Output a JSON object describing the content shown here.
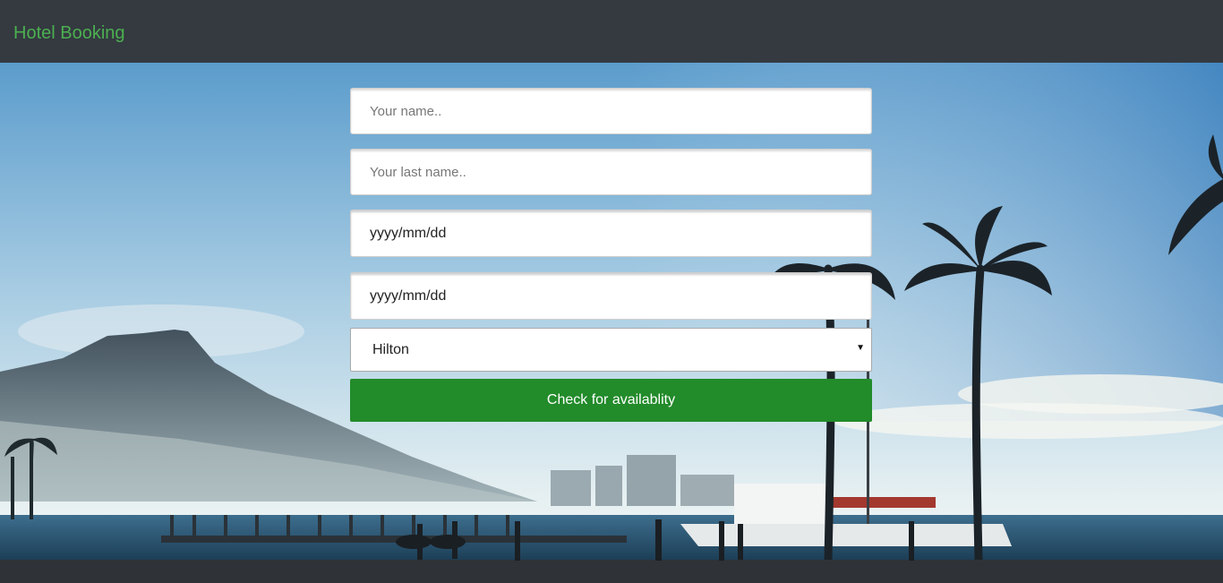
{
  "navbar": {
    "brand": "Hotel Booking",
    "brand_color": "#4caf50",
    "background": "#343a40"
  },
  "hero": {
    "image": "tropical beach with palm trees, mountain and boats"
  },
  "form": {
    "first_name_placeholder": "Your name..",
    "last_name_placeholder": "Your last name..",
    "check_in_format": "yyyy/mm/dd",
    "check_out_format": "yyyy/mm/dd",
    "hotel_selected": "Hilton",
    "submit_label": "Check for availablity",
    "submit_color": "#228b2a"
  }
}
